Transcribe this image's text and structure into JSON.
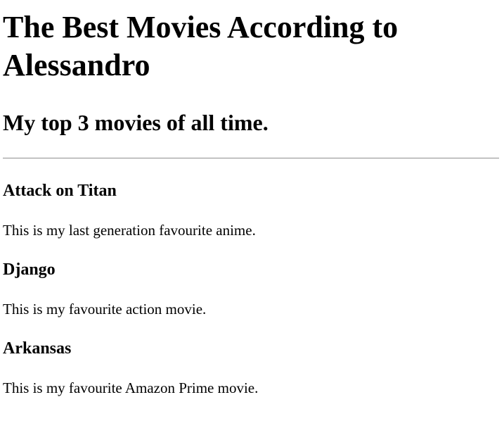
{
  "page": {
    "title": "The Best Movies According to Alessandro",
    "subtitle": "My top 3 movies of all time."
  },
  "movies": [
    {
      "name": "Attack on Titan",
      "description": "This is my last generation favourite anime."
    },
    {
      "name": "Django",
      "description": "This is my favourite action movie."
    },
    {
      "name": "Arkansas",
      "description": "This is my favourite Amazon Prime movie."
    }
  ]
}
